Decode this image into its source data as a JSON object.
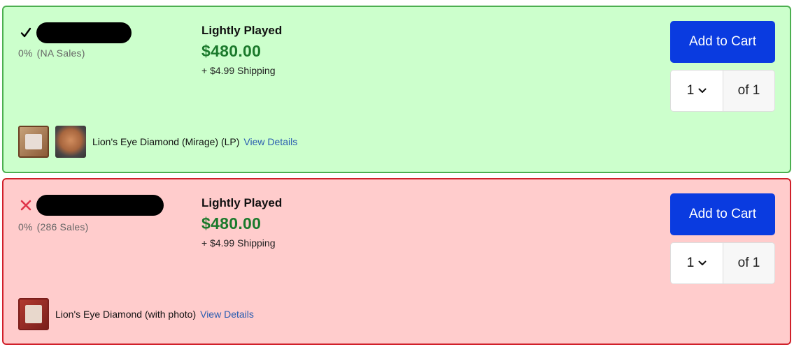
{
  "listings": [
    {
      "status": "match",
      "status_icon": "check-icon",
      "status_color": "#000000",
      "feedback_percent": "0%",
      "feedback_sales": "(NA Sales)",
      "condition": "Lightly Played",
      "price": "$480.00",
      "shipping": "+ $4.99 Shipping",
      "add_to_cart_label": "Add to Cart",
      "quantity": "1",
      "quantity_of": "of 1",
      "card_title": "Lion's Eye Diamond (Mirage) (LP)",
      "view_details_label": "View Details",
      "background": "#ccffcc",
      "border": "#4caf50"
    },
    {
      "status": "no-match",
      "status_icon": "x-icon",
      "status_color": "#e0334a",
      "feedback_percent": "0%",
      "feedback_sales": "(286 Sales)",
      "condition": "Lightly Played",
      "price": "$480.00",
      "shipping": "+ $4.99 Shipping",
      "add_to_cart_label": "Add to Cart",
      "quantity": "1",
      "quantity_of": "of 1",
      "card_title": "Lion's Eye Diamond (with photo)",
      "view_details_label": "View Details",
      "background": "#ffcccc",
      "border": "#d0202a"
    }
  ],
  "colors": {
    "price_green": "#1b7a2c",
    "button_blue": "#0a3be0",
    "link_blue": "#2a5db0"
  }
}
